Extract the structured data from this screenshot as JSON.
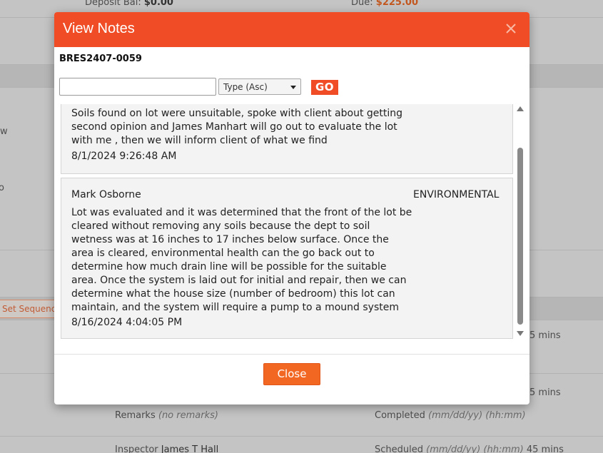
{
  "background": {
    "deposit_label": "Deposit Bal:",
    "deposit_value": "$0.00",
    "due_label": "Due:",
    "due_value": "$225.00",
    "left_frag_1": "w",
    "left_frag_2": "o",
    "set_sequence": "Set Sequenc",
    "mins_1": "5 mins",
    "mins_2": "5 mins",
    "remarks_label": "Remarks",
    "remarks_value": "(no remarks)",
    "completed_label": "Completed",
    "completed_value": "(mm/dd/yy) (hh:mm)",
    "inspector_label": "Inspector",
    "inspector_value": "James T Hall",
    "scheduled_label": "Scheduled",
    "scheduled_value": "(mm/dd/yy) (hh:mm)",
    "scheduled_mins": "45 mins"
  },
  "modal": {
    "title": "View Notes",
    "reference": "BRES2407-0059",
    "search": {
      "value": "",
      "placeholder": ""
    },
    "sort": {
      "selected": "Type (Asc)"
    },
    "go_label": "GO",
    "close_label": "Close"
  },
  "notes": [
    {
      "author": "",
      "type": "",
      "text": "Soils found on lot were unsuitable, spoke with client about getting second opinion and James Manhart will go out to evaluate the lot with me , then we will inform client of what we find",
      "date": "8/1/2024 9:26:48 AM"
    },
    {
      "author": "Mark Osborne",
      "type": "ENVIRONMENTAL",
      "text": "Lot was evaluated and it was determined that the front of the lot be cleared without removing any soils because the dept to soil wetness was at 16 inches to 17 inches below surface. Once the area is cleared, environmental health can the go back out to determine how much drain line will be possible for the suitable area. Once the system is laid out for initial and repair, then we can determine what the house size (number of bedroom) this lot can maintain, and the system will require a pump to a mound system",
      "date": "8/16/2024 4:04:05 PM"
    }
  ],
  "colors": {
    "header": "#f04d26",
    "go_button": "#f04d26",
    "close_button": "#f26822"
  }
}
